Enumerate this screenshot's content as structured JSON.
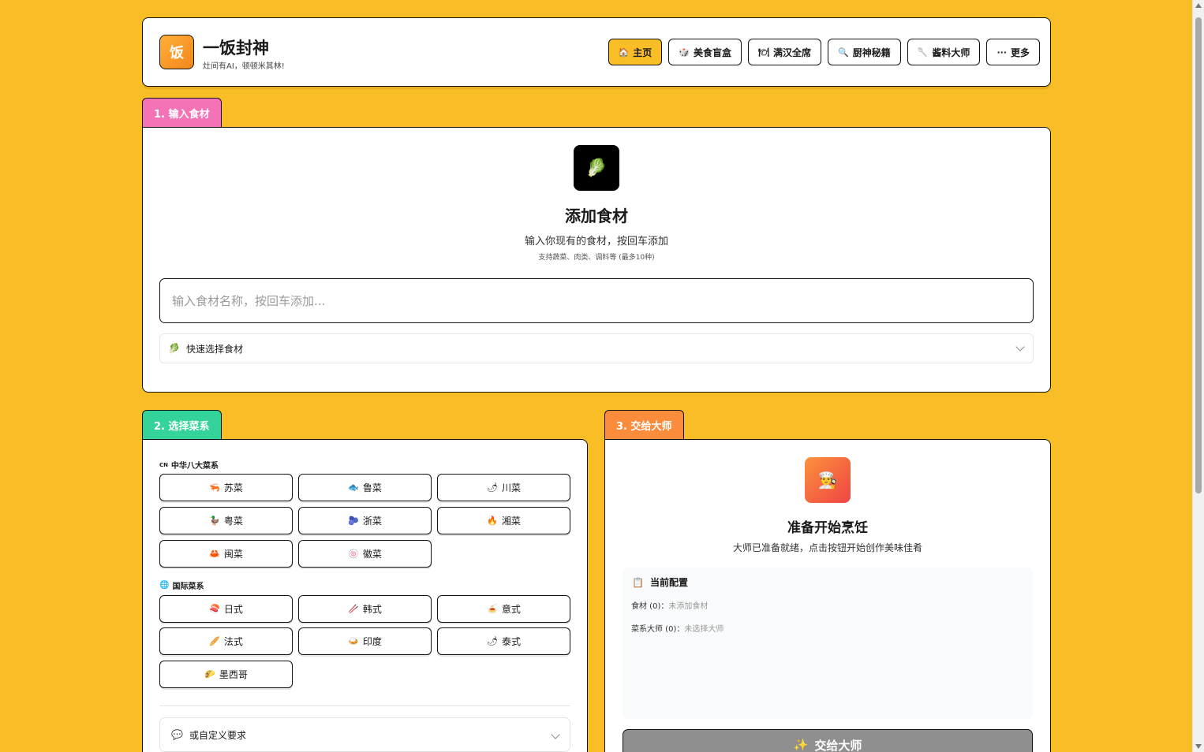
{
  "header": {
    "logo_char": "饭",
    "title": "一饭封神",
    "slogan": "灶间有AI，顿顿米其林!",
    "nav": [
      {
        "icon": "🏠",
        "label": "主页",
        "active": true
      },
      {
        "icon": "🎲",
        "label": "美食盲盒"
      },
      {
        "icon": "🍽",
        "label": "满汉全席"
      },
      {
        "icon": "🔍",
        "label": "厨神秘籍"
      },
      {
        "icon": "🥄",
        "label": "酱料大师"
      },
      {
        "icon": "···",
        "label": "更多"
      }
    ]
  },
  "step1": {
    "tab": "1. 输入食材",
    "icon": "🥬",
    "title": "添加食材",
    "desc": "输入你现有的食材，按回车添加",
    "hint": "支持蔬菜、肉类、调料等 (最多10种)",
    "input_placeholder": "输入食材名称，按回车添加...",
    "quick_icon": "🥬",
    "quick_label": "快速选择食材"
  },
  "step2": {
    "tab": "2. 选择菜系",
    "chinese_group": {
      "icon": "CN",
      "title": "中华八大菜系"
    },
    "chinese": [
      {
        "icon": "🦐",
        "label": "苏菜"
      },
      {
        "icon": "🐟",
        "label": "鲁菜"
      },
      {
        "icon": "🌶",
        "label": "川菜"
      },
      {
        "icon": "🦆",
        "label": "粤菜"
      },
      {
        "icon": "🫐",
        "label": "浙菜"
      },
      {
        "icon": "🔥",
        "label": "湘菜"
      },
      {
        "icon": "🦀",
        "label": "闽菜"
      },
      {
        "icon": "🍥",
        "label": "徽菜"
      }
    ],
    "intl_group": {
      "icon": "🌐",
      "title": "国际菜系"
    },
    "international": [
      {
        "icon": "🍣",
        "label": "日式"
      },
      {
        "icon": "🥢",
        "label": "韩式"
      },
      {
        "icon": "🍝",
        "label": "意式"
      },
      {
        "icon": "🥖",
        "label": "法式"
      },
      {
        "icon": "🍛",
        "label": "印度"
      },
      {
        "icon": "🌶",
        "label": "泰式"
      },
      {
        "icon": "🌮",
        "label": "墨西哥"
      }
    ],
    "custom_icon": "💬",
    "custom_label": "或自定义要求"
  },
  "step3": {
    "tab": "3. 交给大师",
    "icon": "👨‍🍳",
    "title": "准备开始烹饪",
    "desc": "大师已准备就绪，点击按钮开始创作美味佳肴",
    "config_icon": "📋",
    "config_title": "当前配置",
    "ingredients_label": "食材 (0)：",
    "ingredients_value": "未添加食材",
    "chef_label": "菜系大师 (0)：",
    "chef_value": "未选择大师",
    "submit_icon": "✨",
    "submit_label": "交给大师"
  },
  "colors": {
    "background": "#f9bd25",
    "tab1": "#f472b6",
    "tab2": "#34d399",
    "tab3": "#fb8c3c",
    "submit_disabled": "#8f8f8f"
  }
}
